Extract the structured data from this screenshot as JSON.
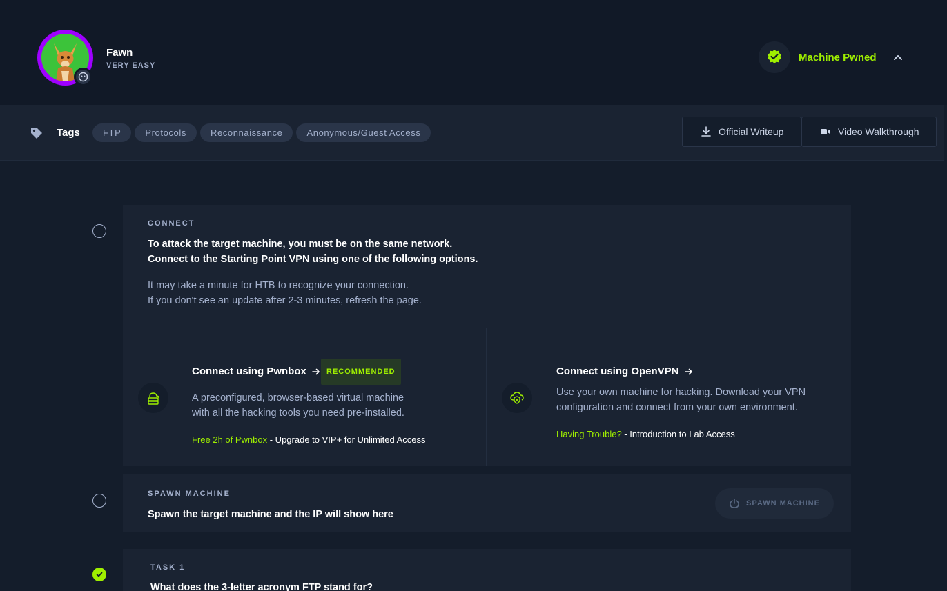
{
  "machine": {
    "name": "Fawn",
    "difficulty": "VERY EASY",
    "status": "Machine Pwned"
  },
  "tags": {
    "label": "Tags",
    "items": [
      "FTP",
      "Protocols",
      "Reconnaissance",
      "Anonymous/Guest Access"
    ]
  },
  "actions": {
    "writeup": "Official Writeup",
    "video": "Video Walkthrough"
  },
  "connect": {
    "label": "CONNECT",
    "title_line1": "To attack the target machine, you must be on the same network.",
    "title_line2": "Connect to the Starting Point VPN using one of the following options.",
    "text_line1": "It may take a minute for HTB to recognize your connection.",
    "text_line2": "If you don't see an update after 2-3 minutes, refresh the page.",
    "pwnbox": {
      "title": "Connect using Pwnbox",
      "badge": "RECOMMENDED",
      "desc_line1": "A preconfigured, browser-based virtual machine",
      "desc_line2": "with all the hacking tools you need pre-installed.",
      "foot_highlight": "Free 2h of Pwnbox",
      "foot_rest": " - Upgrade to VIP+ for Unlimited Access"
    },
    "openvpn": {
      "title": "Connect using OpenVPN",
      "desc_line1": "Use your own machine for hacking. Download your VPN",
      "desc_line2": "configuration and connect from your own environment.",
      "foot_highlight": "Having Trouble?",
      "foot_rest": " - Introduction to Lab Access"
    }
  },
  "spawn": {
    "label": "SPAWN MACHINE",
    "title": "Spawn the target machine and the IP will show here",
    "button": "SPAWN MACHINE"
  },
  "task1": {
    "label": "TASK 1",
    "question": "What does the 3-letter acronym FTP stand for?"
  },
  "colors": {
    "accent": "#9fef00",
    "background": "#141d2b",
    "card": "#1a2332",
    "muted": "#a4b1cd",
    "avatar_ring": "#9f00ff"
  }
}
